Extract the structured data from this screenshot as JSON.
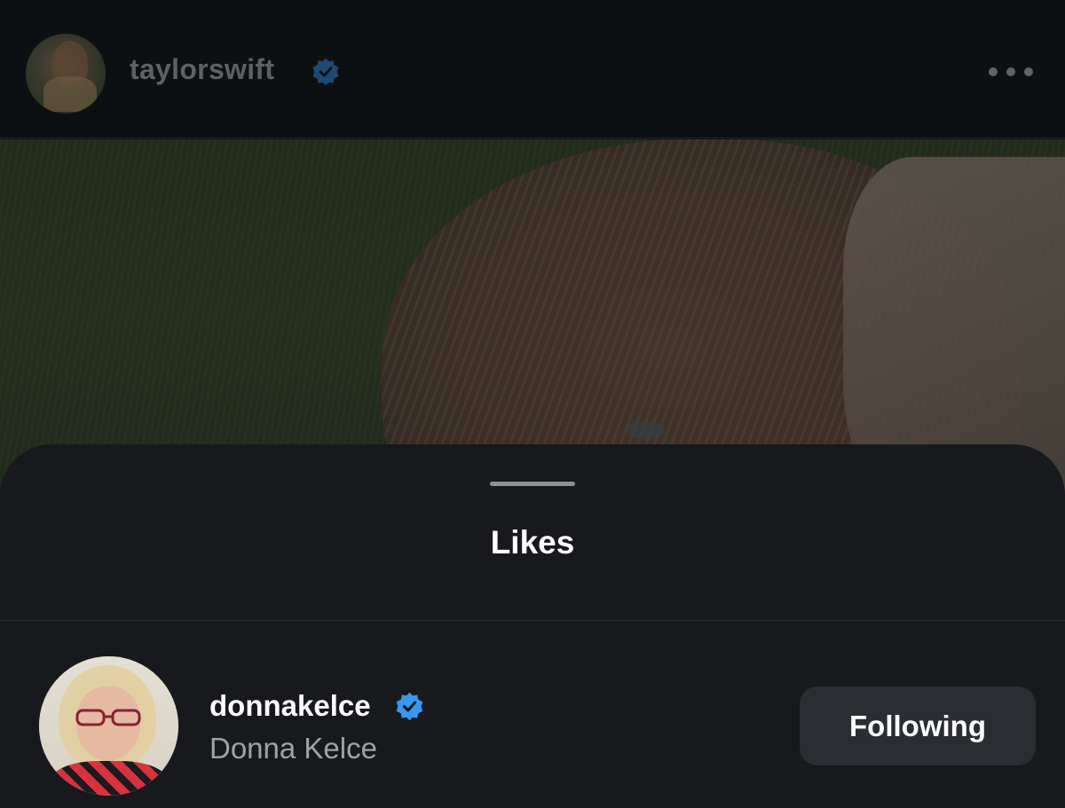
{
  "post": {
    "username": "taylorswift",
    "verified_icon": "verified-badge-icon",
    "more_icon": "more-options-icon"
  },
  "sheet": {
    "title": "Likes"
  },
  "likes": [
    {
      "handle": "donnakelce",
      "full_name": "Donna Kelce",
      "verified": true,
      "button_label": "Following"
    }
  ],
  "colors": {
    "verified_blue": "#3897f0",
    "sheet_bg": "#17191c",
    "button_bg": "#2a2d32"
  }
}
